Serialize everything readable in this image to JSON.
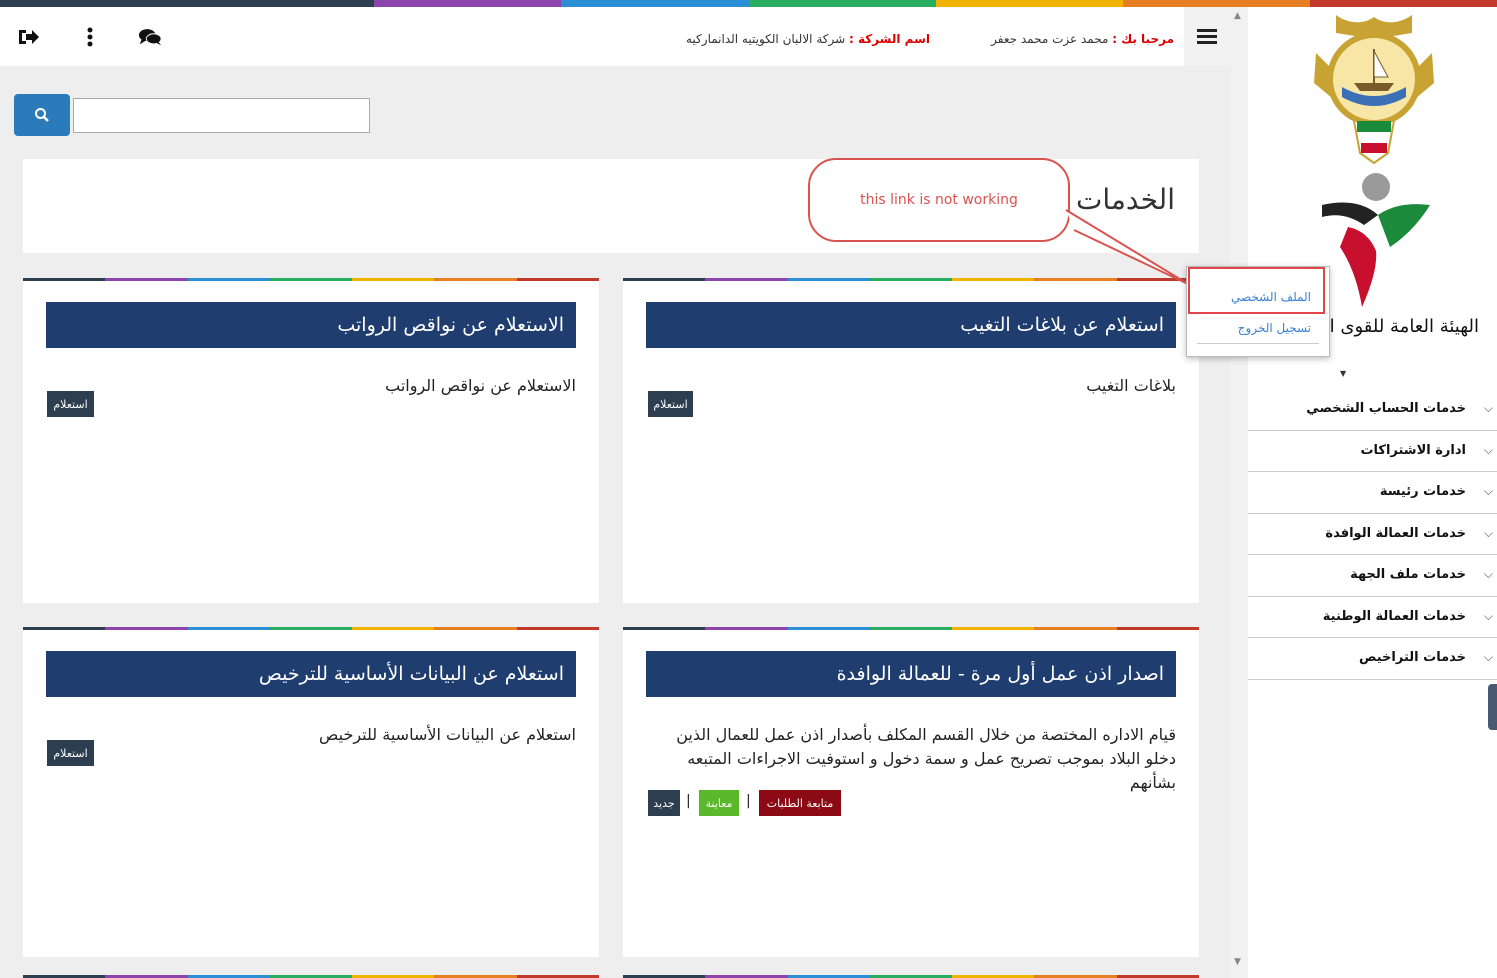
{
  "colors": {
    "stripe": [
      "#2d3e50",
      "#2d3e50",
      "#8e44ad",
      "#2c8fd6",
      "#27ae60",
      "#f0b400",
      "#e67e22",
      "#c0392b"
    ],
    "card_stripe": [
      "#2d3e50",
      "#8e44ad",
      "#2c8fd6",
      "#27ae60",
      "#f0b400",
      "#e67e22",
      "#c0392b"
    ],
    "card_header": "#1f3d6e",
    "btn_dark": "#2d3e50",
    "btn_green": "#5cb82b",
    "btn_maroon": "#8b0a14",
    "callout": "#d9534f"
  },
  "header": {
    "welcome_label": "مرحبا بك :",
    "user_name": "محمد عزت محمد جعفر",
    "company_label": "اسم الشركة :",
    "company_name": "شركة الالبان الكويتيه الدانماركيه",
    "icons": [
      "menu-icon",
      "chat-icon",
      "more-vertical-icon",
      "logout-icon"
    ]
  },
  "search": {
    "value": "",
    "icon": "search-icon"
  },
  "services": {
    "title": "الخدمات"
  },
  "cards": [
    {
      "title": "استعلام عن بلاغات التغيب",
      "description": "بلاغات التغيب",
      "buttons": [
        "استعلام"
      ]
    },
    {
      "title": "الاستعلام عن نواقص الرواتب",
      "description": "الاستعلام عن نواقص الرواتب",
      "buttons": [
        "استعلام"
      ]
    },
    {
      "title": "اصدار اذن عمل أول مرة - للعمالة الوافدة",
      "description": "قيام الاداره المختصة من خلال القسم المكلف بأصدار اذن عمل للعمال الذين دخلو البلاد بموجب تصريح عمل و سمة دخول و استوفيت الاجراءات المتبعه بشأنهم",
      "buttons": [
        "متابعة الطلبات",
        "معاينة",
        "جديد"
      ],
      "separator": "|"
    },
    {
      "title": "استعلام عن البيانات الأساسية للترخيص",
      "description": "استعلام عن البيانات الأساسية للترخيص",
      "buttons": [
        "استعلام"
      ]
    }
  ],
  "sidebar": {
    "agency_name": "الهيئة العامة للقوى العاملة",
    "menu": [
      "خدمات الحساب الشخصي",
      "ادارة الاشتراكات",
      "خدمات رئيسة",
      "خدمات العمالة الوافدة",
      "خدمات ملف الجهة",
      "خدمات العمالة الوطنية",
      "خدمات التراخيص"
    ]
  },
  "dropdown": {
    "items": [
      "الملف الشخصي",
      "تسجيل الخروج"
    ]
  },
  "annotation": {
    "callout_text": "this link is not working"
  }
}
